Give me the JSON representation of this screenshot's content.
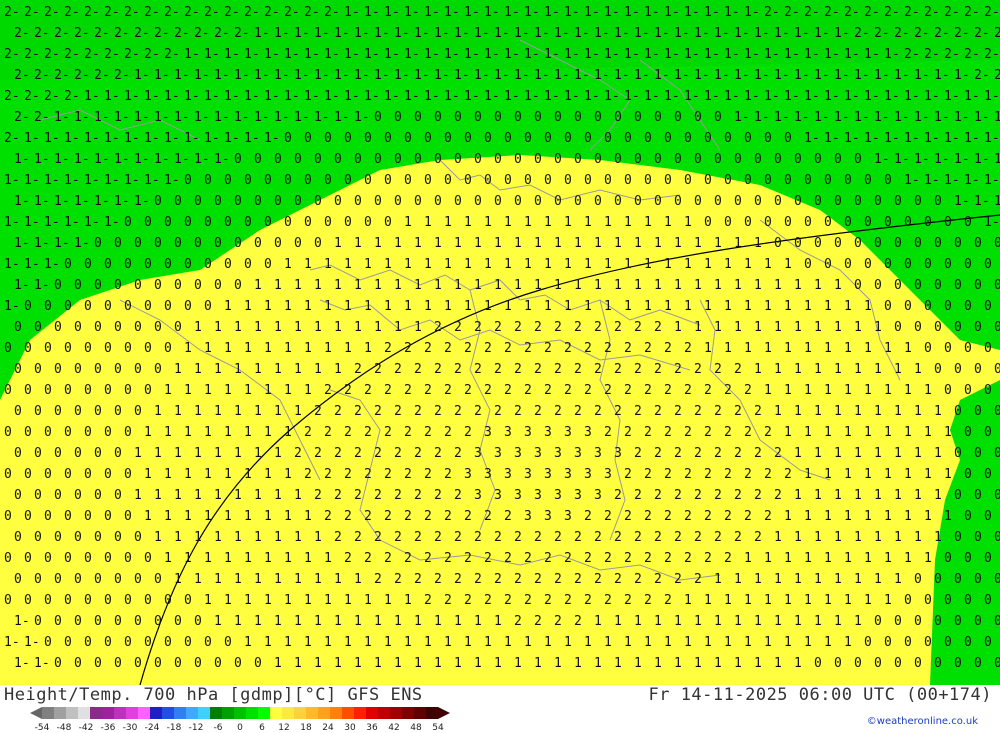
{
  "title": {
    "left": "Height/Temp. 700 hPa [gdmp][°C] GFS ENS",
    "right": "Fr 14-11-2025 06:00 UTC (00+174)"
  },
  "credit": "©weatheronline.co.uk",
  "legend": {
    "ticks": [
      "-54",
      "-48",
      "-42",
      "-36",
      "-30",
      "-24",
      "-18",
      "-12",
      "-6",
      "0",
      "6",
      "12",
      "18",
      "24",
      "30",
      "36",
      "42",
      "48",
      "54"
    ],
    "colors": [
      "#808080",
      "#a0a0a0",
      "#c0c0c0",
      "#e0e0e0",
      "#8a2b8a",
      "#a020a0",
      "#c030c0",
      "#e040e0",
      "#ff60ff",
      "#2020c0",
      "#2050e0",
      "#3080f0",
      "#40a8ff",
      "#40d0ff",
      "#008000",
      "#00a000",
      "#00c000",
      "#00e000",
      "#00ff00",
      "#ffff40",
      "#ffe840",
      "#ffd040",
      "#ffb830",
      "#ffa020",
      "#ff8010",
      "#ff5000",
      "#ff2000",
      "#e00000",
      "#c00000",
      "#a00000",
      "#800000",
      "#600000",
      "#400000"
    ]
  },
  "map": {
    "colors": {
      "cold": "#00e000",
      "mild": "#ffff40",
      "contour_label": "#111111",
      "border": "#9a9a9a",
      "height_line": "#000000"
    }
  }
}
